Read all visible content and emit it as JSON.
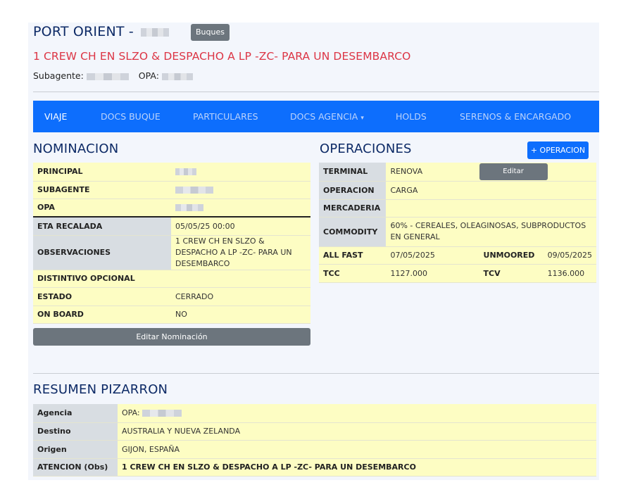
{
  "header": {
    "vessel_name": "PORT ORIENT -",
    "buques_label": "Buques",
    "subtitle": "1 CREW CH EN SLZO & DESPACHO A LP -ZC- PARA UN DESEMBARCO",
    "subagente_label": "Subagente:",
    "opa_label": "OPA:"
  },
  "nav": {
    "tabs": [
      "VIAJE",
      "DOCS BUQUE",
      "PARTICULARES",
      "DOCS AGENCIA",
      "HOLDS",
      "SERENOS & ENCARGADO"
    ],
    "active": "VIAJE",
    "dropdown_caret": "▾"
  },
  "nominacion": {
    "title": "NOMINACION",
    "rows": [
      {
        "label": "PRINCIPAL",
        "value": ""
      },
      {
        "label": "SUBAGENTE",
        "value": ""
      },
      {
        "label": "OPA",
        "value": ""
      },
      {
        "label": "ETA RECALADA",
        "value": "05/05/25 00:00"
      },
      {
        "label": "OBSERVACIONES",
        "value": "1 CREW CH EN SLZO & DESPACHO A LP -ZC- PARA UN DESEMBARCO"
      },
      {
        "label": "DISTINTIVO OPCIONAL",
        "value": ""
      },
      {
        "label": "ESTADO",
        "value": "CERRADO"
      },
      {
        "label": "ON BOARD",
        "value": "NO"
      }
    ],
    "edit_button": "Editar Nominación"
  },
  "operaciones": {
    "title": "OPERACIONES",
    "add_button": "+ OPERACION",
    "edit_button": "Editar",
    "terminal": {
      "label": "TERMINAL",
      "value": "RENOVA"
    },
    "operacion": {
      "label": "OPERACION",
      "value": "CARGA"
    },
    "mercaderia": {
      "label": "MERCADERIA",
      "value": ""
    },
    "commodity": {
      "label": "COMMODITY",
      "value": "60% - CEREALES, OLEAGINOSAS, SUBPRODUCTOS EN GENERAL"
    },
    "all_fast": {
      "label": "ALL FAST",
      "value": "07/05/2025"
    },
    "unmoored": {
      "label": "UNMOORED",
      "value": "09/05/2025"
    },
    "tcc": {
      "label": "TCC",
      "value": "1127.000"
    },
    "tcv": {
      "label": "TCV",
      "value": "1136.000"
    }
  },
  "resumen": {
    "title": "RESUMEN PIZARRON",
    "rows": [
      {
        "label": "Agencia",
        "value": "OPA:"
      },
      {
        "label": "Destino",
        "value": "AUSTRALIA  Y NUEVA ZELANDA"
      },
      {
        "label": "Origen",
        "value": "GIJON,  ESPAÑA"
      },
      {
        "label": "ATENCION (Obs)",
        "value": "1 CREW CH EN SLZO & DESPACHO A LP -ZC- PARA UN DESEMBARCO"
      }
    ]
  }
}
